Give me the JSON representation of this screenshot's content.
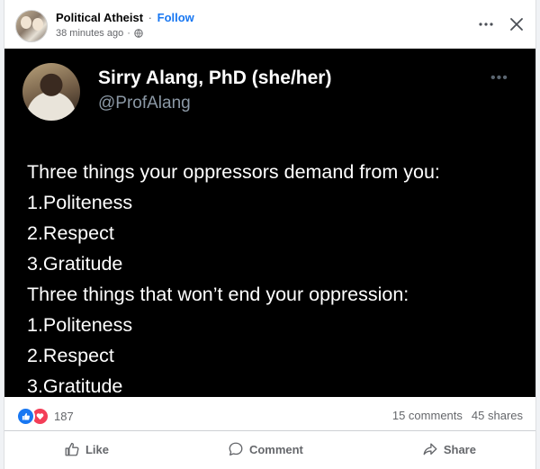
{
  "header": {
    "page_name": "Political Atheist",
    "separator": "·",
    "follow_label": "Follow",
    "timestamp": "38 minutes ago",
    "meta_separator": "·",
    "more_icon": "more-horizontal-icon",
    "close_icon": "close-icon"
  },
  "tweet": {
    "author_name": "Sirry Alang, PhD (she/her)",
    "handle": "@ProfAlang",
    "more_label": "•••",
    "lines": [
      "Three things your oppressors demand from you:",
      "1.Politeness",
      "2.Respect",
      "3.Gratitude",
      "Three things that won’t end your oppression:",
      "1.Politeness",
      "2.Respect",
      "3.Gratitude"
    ]
  },
  "stats": {
    "reaction_count": "187",
    "comments": "15 comments",
    "shares": "45 shares"
  },
  "actions": {
    "like": "Like",
    "comment": "Comment",
    "share": "Share"
  },
  "colors": {
    "accent": "#1877f2",
    "love": "#f33e58",
    "muted": "#65676b",
    "tweet_bg": "#000000"
  }
}
